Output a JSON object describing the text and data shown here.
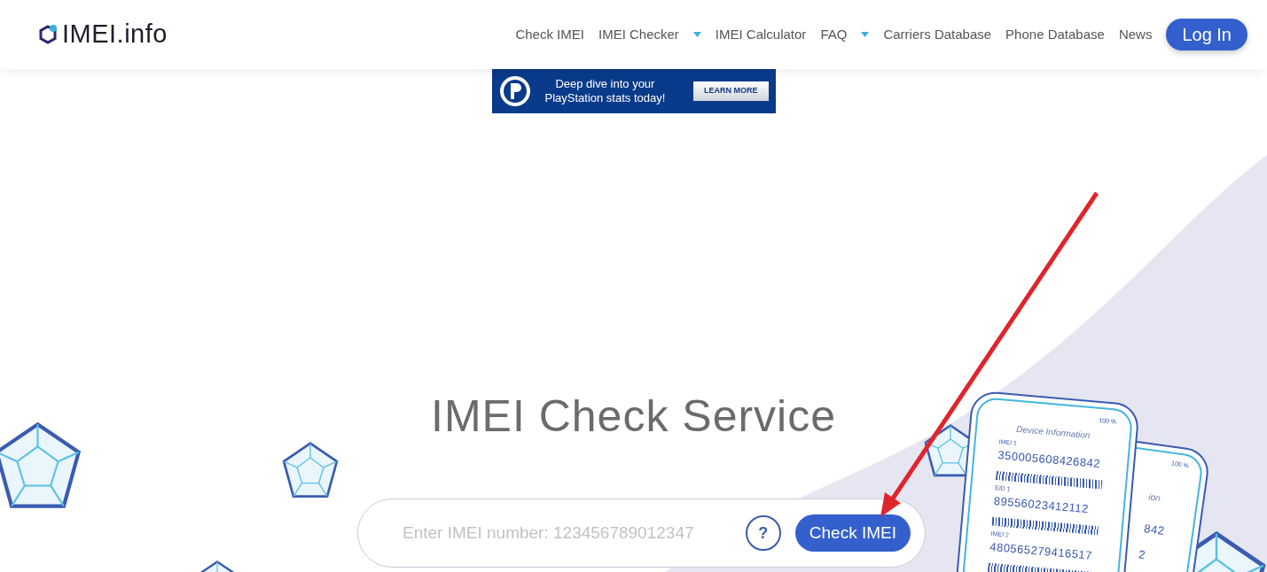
{
  "header": {
    "logo": "IMEI.info",
    "nav": [
      {
        "label": "Check IMEI",
        "dropdown": false
      },
      {
        "label": "IMEI Checker",
        "dropdown": true
      },
      {
        "label": "IMEI Calculator",
        "dropdown": false
      },
      {
        "label": "FAQ",
        "dropdown": true
      },
      {
        "label": "Carriers Database",
        "dropdown": false
      },
      {
        "label": "Phone Database",
        "dropdown": false
      },
      {
        "label": "News",
        "dropdown": false
      }
    ],
    "login": "Log In"
  },
  "ad": {
    "headline_lines": [
      "Deep dive into your",
      "PlayStation stats today!"
    ],
    "button": "LEARN MORE"
  },
  "hero": {
    "title": "IMEI Check Service",
    "search": {
      "placeholder": "Enter IMEI number: 123456789012347",
      "help": "?",
      "button": "Check IMEI"
    }
  },
  "illustration": {
    "front_phone": {
      "battery": "100 %",
      "heading": "Device Information",
      "entries": [
        {
          "label": "IMEI 1",
          "number": "350005608426842"
        },
        {
          "label": "EID 1",
          "number": "89556023412112"
        },
        {
          "label": "IMEI 2",
          "number": "480565279416517"
        }
      ]
    },
    "back_phone": {
      "battery": "100 %",
      "texts": [
        "ion",
        "842",
        "2"
      ]
    }
  }
}
